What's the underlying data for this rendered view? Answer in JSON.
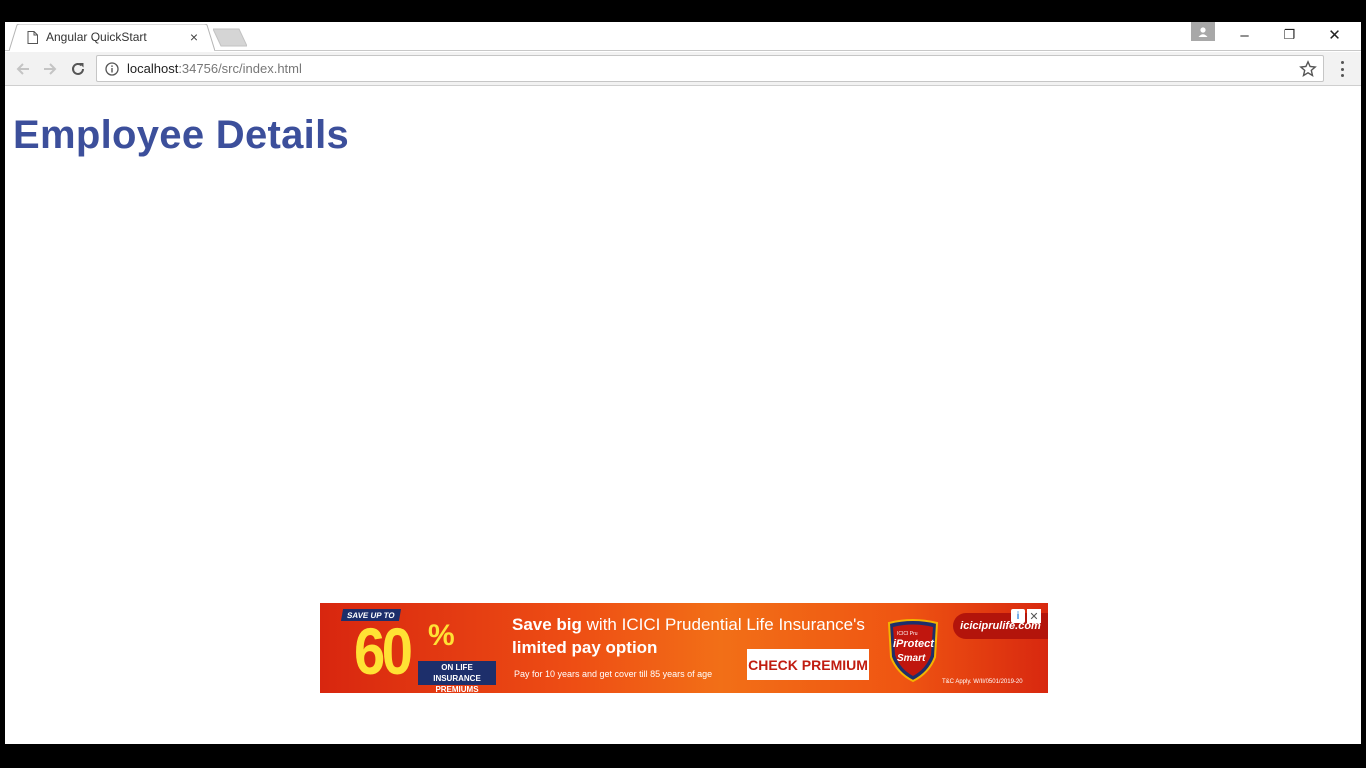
{
  "browser": {
    "tab_title": "Angular QuickStart",
    "tab_close": "×",
    "url_host": "localhost",
    "url_rest": ":34756/src/index.html",
    "window_controls": {
      "minimize": "–",
      "restore": "❐",
      "close": "✕"
    }
  },
  "page": {
    "heading": "Employee Details"
  },
  "ad": {
    "save_up_to": "SAVE UP TO",
    "percent_value": "60",
    "percent_sign": "%",
    "premiums_line1": "ON LIFE INSURANCE",
    "premiums_line2": "PREMIUMS",
    "headline_bold": "Save big",
    "headline_rest": " with ICICI Prudential Life Insurance's",
    "headline_line2": "limited pay option",
    "subtext": "Pay for 10 years and get cover till 85 years of age",
    "cta_label": "CHECK PREMIUM",
    "shield_top": "ICICI Pru",
    "shield_brand": "iProtect",
    "shield_smart": "Smart",
    "domain": "iciciprulife.com",
    "tnc": "T&C Apply.  W/II/0501/2019-20",
    "colors": {
      "primary": "#ee4e14",
      "accent": "#ffe234",
      "navy": "#1d2f6b"
    }
  },
  "colors": {
    "heading": "#3c4f9b"
  }
}
